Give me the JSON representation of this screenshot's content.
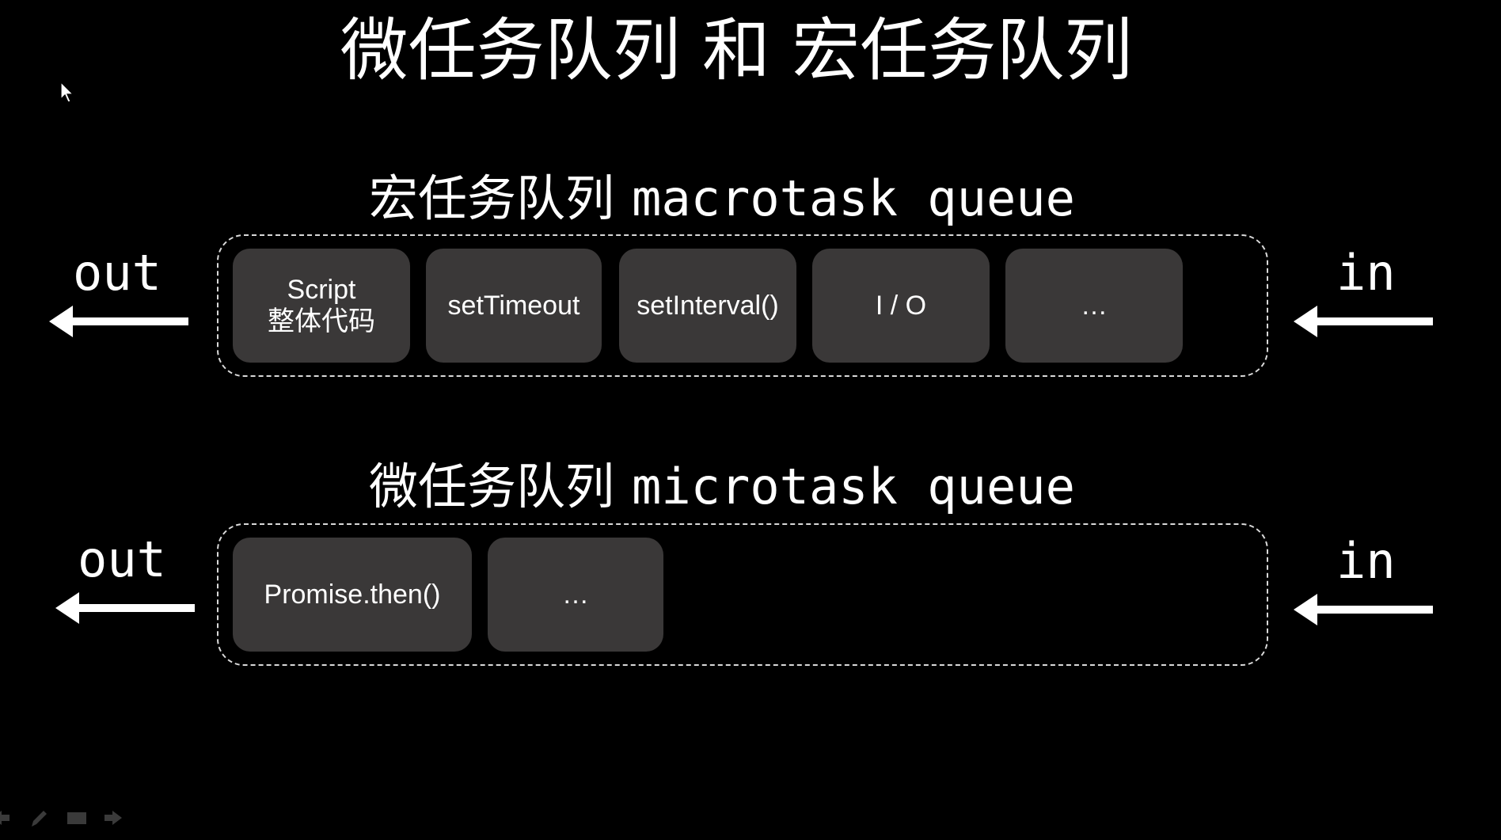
{
  "title": "微任务队列 和 宏任务队列",
  "macro": {
    "heading_zh": "宏任务队列",
    "heading_en": "macrotask queue",
    "out_label": "out",
    "in_label": "in",
    "tasks": [
      {
        "line1": "Script",
        "line2": "整体代码"
      },
      {
        "line1": "setTimeout",
        "line2": ""
      },
      {
        "line1": "setInterval()",
        "line2": ""
      },
      {
        "line1": "I / O",
        "line2": ""
      },
      {
        "line1": "…",
        "line2": ""
      }
    ]
  },
  "micro": {
    "heading_zh": "微任务队列",
    "heading_en": "microtask queue",
    "out_label": "out",
    "in_label": "in",
    "tasks": [
      {
        "line1": "Promise.then()",
        "line2": ""
      },
      {
        "line1": "…",
        "line2": ""
      }
    ]
  },
  "colors": {
    "background": "#000000",
    "task_fill": "#3a3838",
    "text": "#ffffff",
    "dashed_border": "#d9d9d9"
  },
  "toolbar": {
    "icons": [
      "previous-icon",
      "pen-icon",
      "slides-icon",
      "next-icon"
    ]
  }
}
